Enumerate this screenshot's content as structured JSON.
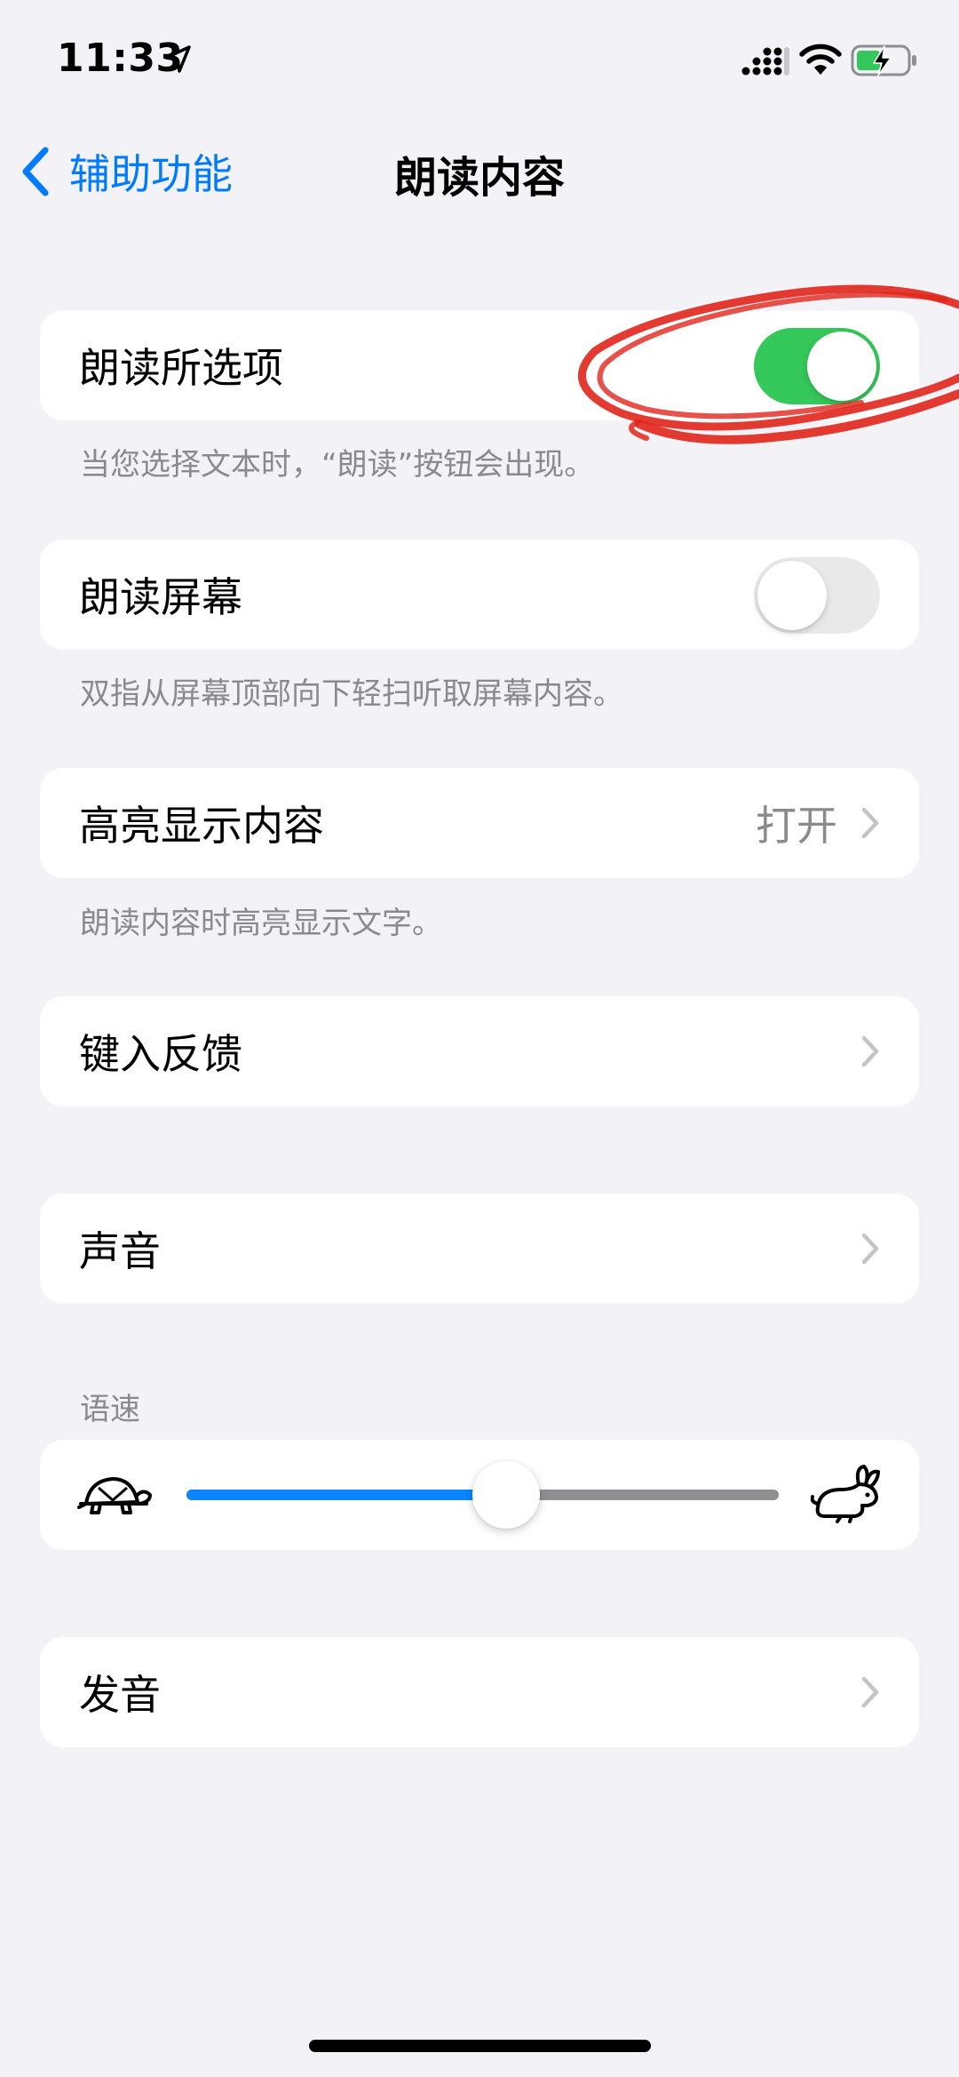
{
  "status_bar": {
    "time": "11:33",
    "icons": [
      "location-arrow-icon",
      "signal-icon",
      "wifi-icon",
      "battery-charging-icon"
    ]
  },
  "nav": {
    "back_label": "辅助功能",
    "title": "朗读内容"
  },
  "speak_selection": {
    "label": "朗读所选项",
    "enabled": true,
    "footer": "当您选择文本时，“朗读”按钮会出现。"
  },
  "speak_screen": {
    "label": "朗读屏幕",
    "enabled": false,
    "footer": "双指从屏幕顶部向下轻扫听取屏幕内容。"
  },
  "highlight_content": {
    "label": "高亮显示内容",
    "value": "打开",
    "footer": "朗读内容时高亮显示文字。"
  },
  "typing_feedback": {
    "label": "键入反馈"
  },
  "voices": {
    "label": "声音"
  },
  "speaking_rate": {
    "header": "语速",
    "value_fraction": 0.54,
    "min_icon": "turtle-icon",
    "max_icon": "rabbit-icon"
  },
  "pronunciations": {
    "label": "发音"
  },
  "colors": {
    "accent": "#007AFF",
    "toggle_on": "#34C759",
    "slider_fill": "#0A84FF",
    "annotation": "#E0261B"
  }
}
